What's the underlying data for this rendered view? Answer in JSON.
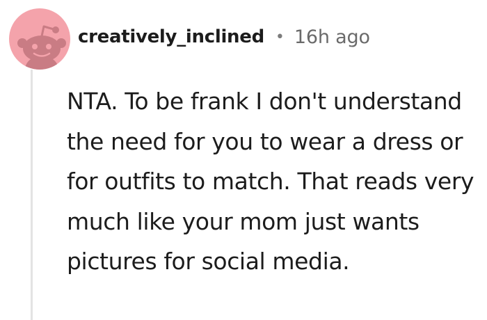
{
  "comment": {
    "author": "creatively_inclined",
    "separator": "•",
    "time": "16h ago",
    "body": "NTA. To be frank I don't understand the need for you to wear a dress or for outfits to match. That reads very much like your mom just wants pictures for social media.",
    "avatar_icon": "snoo-avatar-icon"
  },
  "colors": {
    "avatar_bg": "#f4a3ab",
    "avatar_figure": "#c97c84",
    "thread_line": "#e3e3e3",
    "text": "#1c1c1c",
    "meta": "#6a6a6a"
  }
}
